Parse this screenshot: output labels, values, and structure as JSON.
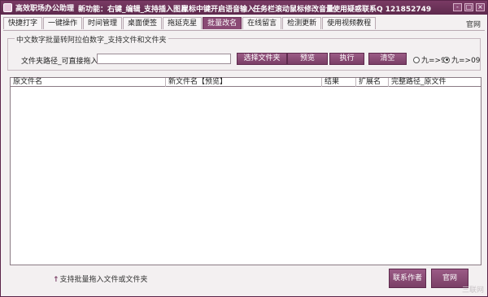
{
  "titlebar": {
    "app_title": "高效职场办公助理",
    "info1": "新功能：右键_编辑_支持插入图片",
    "info2": "鼠标中键开启语音输入",
    "info3": "任务栏滚动鼠标修改音量",
    "info4": "使用疑惑联系Q 121852749",
    "buttons": [
      "-",
      "□",
      "×"
    ]
  },
  "tabs": [
    {
      "label": "快捷打字",
      "active": false
    },
    {
      "label": "一键操作",
      "active": false
    },
    {
      "label": "时间管理",
      "active": false
    },
    {
      "label": "桌面便签",
      "active": false
    },
    {
      "label": "拖延克星",
      "active": false
    },
    {
      "label": "批量改名",
      "active": true
    },
    {
      "label": "在线留言",
      "active": false
    },
    {
      "label": "检测更新",
      "active": false
    },
    {
      "label": "使用视频教程",
      "active": false
    }
  ],
  "top_link": "官网",
  "group": {
    "title": "中文数字批量转阿拉伯数字_支持文件和文件夹",
    "path_label": "文件夹路径_可直接拖入：",
    "path_value": "",
    "buttons": {
      "select_folder": "选择文件夹",
      "preview": "预览",
      "execute": "执行",
      "clear": "清空"
    },
    "radio1": {
      "label": "九=>9",
      "checked": false
    },
    "radio2": {
      "label": "九=>09",
      "checked": true
    }
  },
  "table": {
    "columns": [
      "原文件名",
      "新文件名【预览】",
      "结果",
      "扩展名",
      "完整路径_原文件"
    ],
    "rows": []
  },
  "hint": "支持批量拖入文件或文件夹",
  "bottom_buttons": {
    "contact": "联系作者",
    "website": "官网"
  },
  "watermark": "三联网"
}
